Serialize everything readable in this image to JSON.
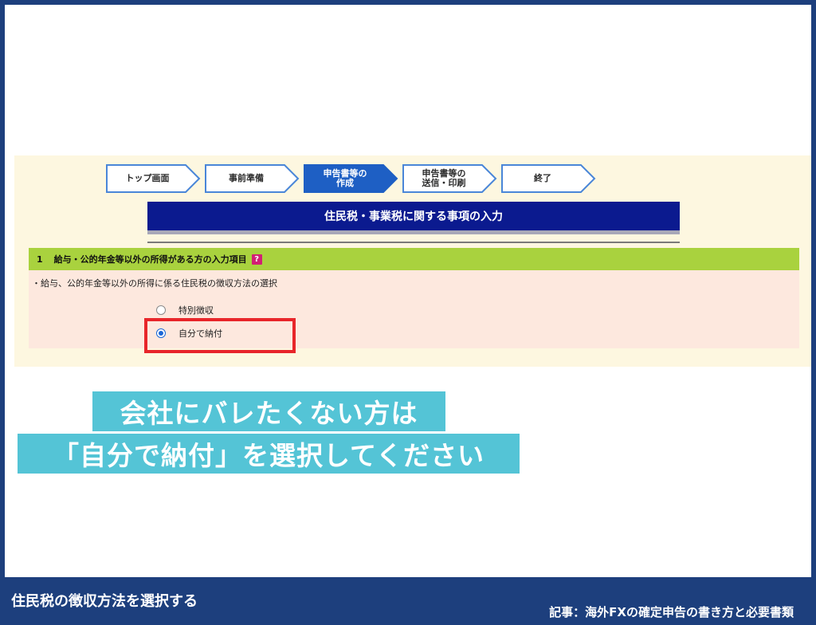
{
  "steps": [
    {
      "label": "トップ画面",
      "active": false
    },
    {
      "label": "事前準備",
      "active": false
    },
    {
      "label": "申告書等の\n作成",
      "active": true
    },
    {
      "label": "申告書等の\n送信・印刷",
      "active": false
    },
    {
      "label": "終了",
      "active": false
    }
  ],
  "page_title": "住民税・事業税に関する事項の入力",
  "section": {
    "number": "1",
    "heading": "給与・公的年金等以外の所得がある方の入力項目",
    "help_icon": "?",
    "description": "・給与、公的年金等以外の所得に係る住民税の徴収方法の選択",
    "options": [
      {
        "label": "特別徴収",
        "checked": false
      },
      {
        "label": "自分で納付",
        "checked": true
      }
    ]
  },
  "caption": {
    "line1": "会社にバレたくない方は",
    "line2": "「自分で納付」を選択してください"
  },
  "footer": {
    "title": "住民税の徴収方法を選択する",
    "article": "記事：海外FXの確定申告の書き方と必要書類"
  },
  "colors": {
    "frame_border": "#1d3f7d",
    "title_bar": "#0b1a8f",
    "section_head": "#a9d23e",
    "section_body": "#fde8de",
    "highlight": "#e8252a",
    "caption_bg": "#54c4d6",
    "active_step": "#1e5fc4"
  }
}
